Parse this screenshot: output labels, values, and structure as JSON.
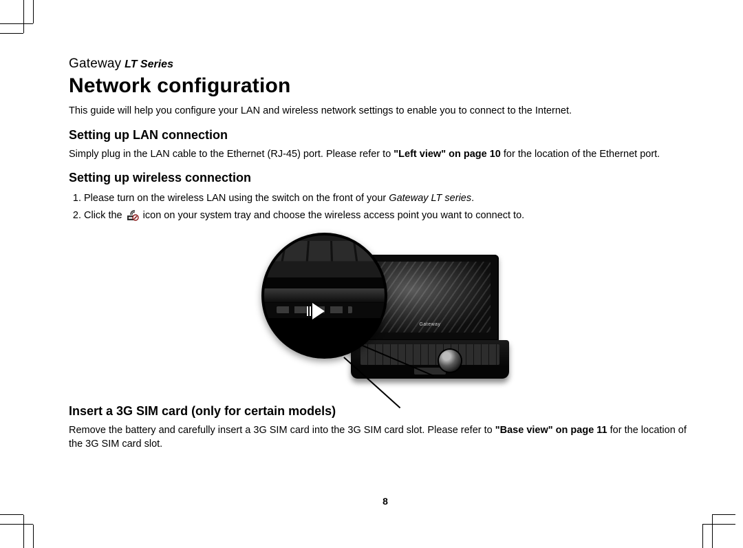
{
  "header": {
    "brand": "Gateway",
    "series": "LT Series"
  },
  "title": "Network configuration",
  "intro": "This guide will help you configure your LAN and wireless network settings to enable you to connect to the Internet.",
  "lan": {
    "heading": "Setting up LAN connection",
    "text_a": "Simply plug in the LAN cable to the Ethernet (RJ-45) port. Please refer to ",
    "ref": "\"Left view\" on page 10",
    "text_b": " for the location of the Ethernet port."
  },
  "wireless": {
    "heading": "Setting up wireless connection",
    "step1_a": "Please turn on the wireless LAN using the switch on the front of your ",
    "step1_em": "Gateway LT series",
    "step1_b": ".",
    "step2_a": "Click the ",
    "step2_b": " icon on your system tray and choose the wireless access point you want to connect to."
  },
  "sim": {
    "heading": "Insert a 3G SIM card (only for certain models)",
    "text_a": "Remove the battery and carefully insert a 3G SIM card into the 3G SIM card slot. Please refer to ",
    "ref": "\"Base view\" on page 11",
    "text_b": " for the location of the 3G SIM card slot."
  },
  "page_number": "8",
  "screen_logo": "Gateway"
}
